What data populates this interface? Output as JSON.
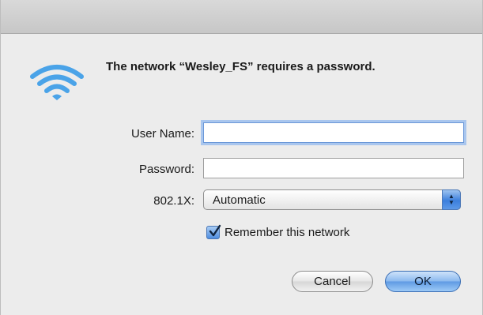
{
  "dialog": {
    "headline": "The network “Wesley_FS” requires a password.",
    "icon": "wifi-icon"
  },
  "form": {
    "username_label": "User Name:",
    "username_value": "",
    "password_label": "Password:",
    "password_value": "",
    "auth_label": "802.1X:",
    "auth_value": "Automatic",
    "remember_label": "Remember this network",
    "remember_checked": true
  },
  "buttons": {
    "cancel": "Cancel",
    "ok": "OK"
  },
  "colors": {
    "accent": "#5e9ae3",
    "wifi": "#4aa3e8"
  }
}
